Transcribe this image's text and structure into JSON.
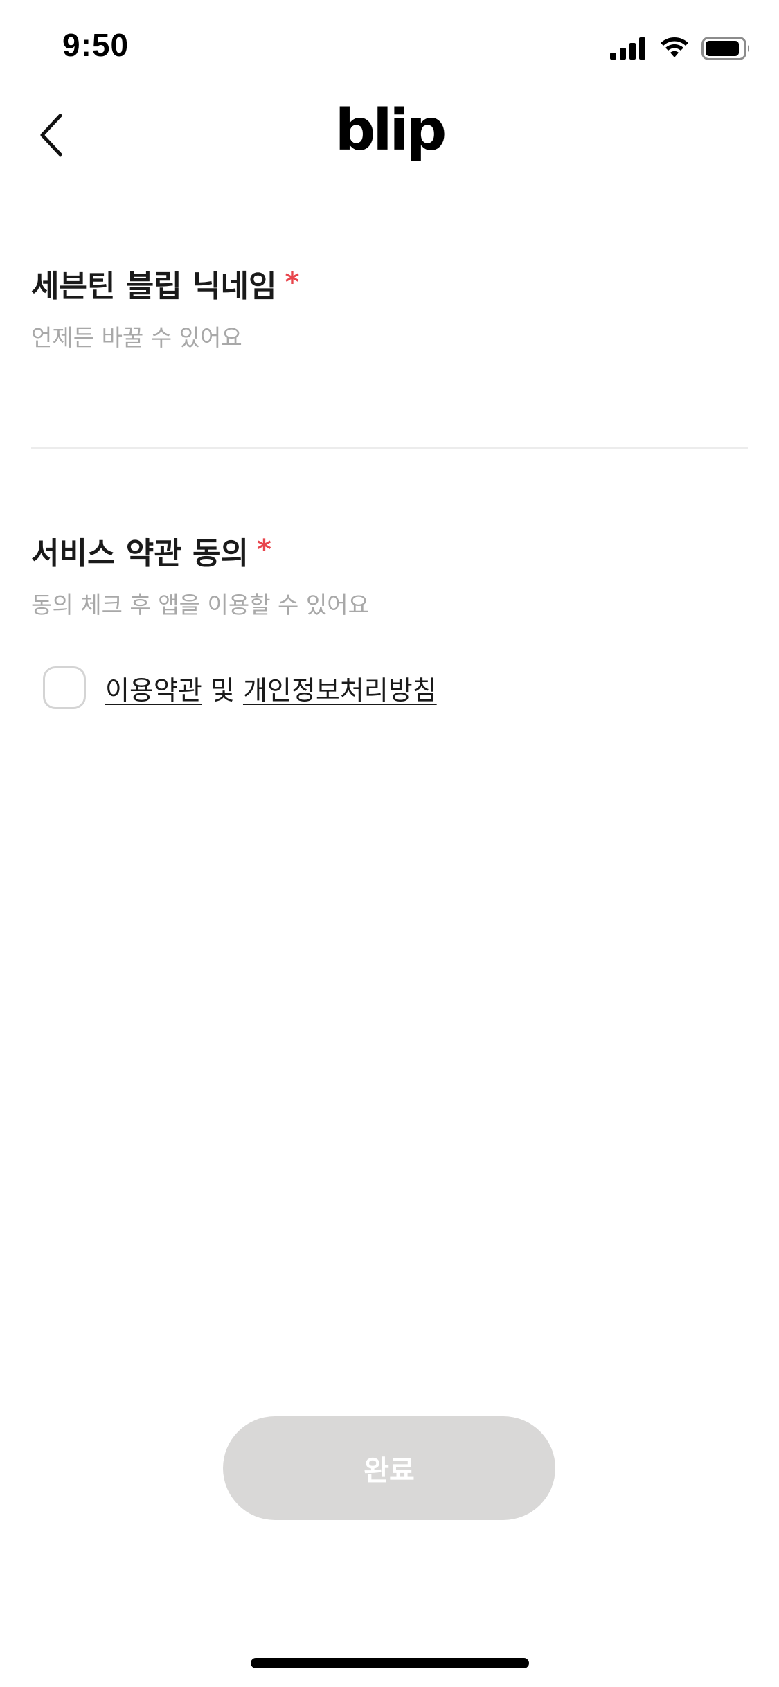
{
  "status_bar": {
    "time": "9:50",
    "icons": [
      "signal-icon",
      "wifi-icon",
      "battery-icon"
    ]
  },
  "nav": {
    "logo": "blip",
    "back_icon": "chevron-left-icon"
  },
  "nickname_section": {
    "title": "세븐틴 블립 닉네임",
    "required_mark": "*",
    "subtitle": "언제든 바꿀 수 있어요",
    "input_value": "",
    "input_placeholder": ""
  },
  "terms_section": {
    "title": "서비스 약관 동의",
    "required_mark": "*",
    "subtitle": "동의 체크 후 앱을 이용할 수 있어요",
    "checkbox_checked": false,
    "terms_link": "이용약관",
    "conjunction": " 및 ",
    "privacy_link": "개인정보처리방침"
  },
  "footer": {
    "done_label": "완료"
  },
  "colors": {
    "required": "#e8454c",
    "subtitle": "#a8a8a8",
    "button_disabled": "#d9d8d7",
    "divider": "#ececec"
  }
}
